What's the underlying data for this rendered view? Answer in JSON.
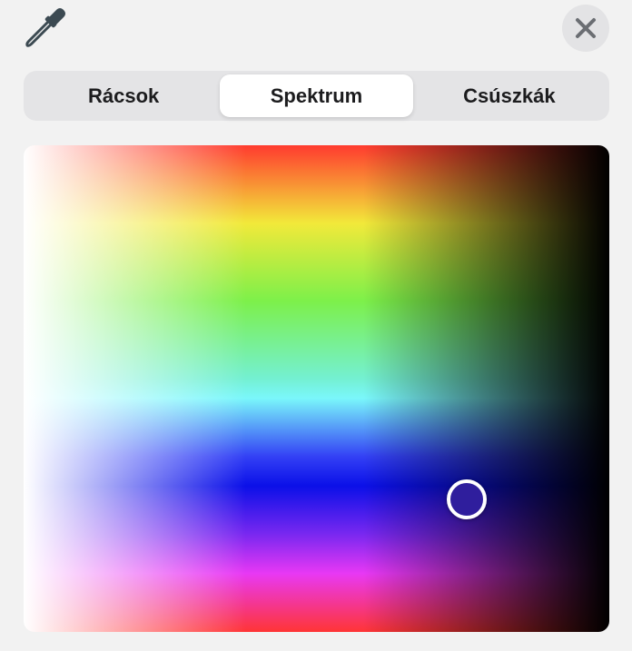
{
  "toolbar": {
    "eyedropper_icon": "eyedropper-icon",
    "close_icon": "close-icon"
  },
  "tabs": [
    {
      "label": "Rácsok",
      "active": false
    },
    {
      "label": "Spektrum",
      "active": true
    },
    {
      "label": "Csúszkák",
      "active": false
    }
  ],
  "spectrum": {
    "selected_color": "#2f1e9d"
  },
  "colors": {
    "background": "#f2f2f2",
    "segment_bg": "#e4e4e6",
    "close_bg": "#e3e3e5",
    "icon": "#3c4a52"
  }
}
